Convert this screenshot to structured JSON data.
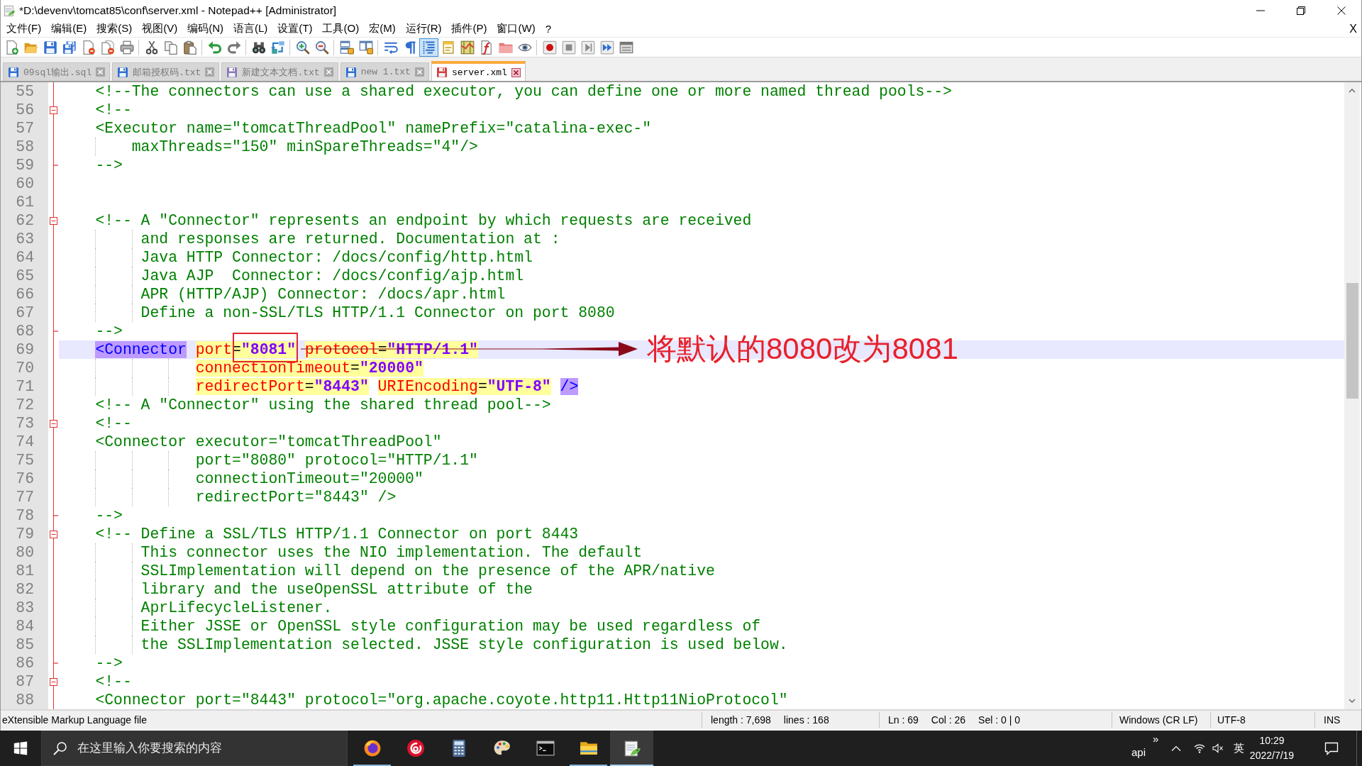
{
  "window": {
    "title": "*D:\\devenv\\tomcat85\\conf\\server.xml - Notepad++ [Administrator]"
  },
  "menu": {
    "items": [
      "文件(F)",
      "编辑(E)",
      "搜索(S)",
      "视图(V)",
      "编码(N)",
      "语言(L)",
      "设置(T)",
      "工具(O)",
      "宏(M)",
      "运行(R)",
      "插件(P)",
      "窗口(W)",
      "?"
    ],
    "close": "X"
  },
  "toolbar": [
    [
      {
        "kind": "new",
        "pressed": false
      },
      {
        "kind": "open",
        "pressed": false
      },
      {
        "kind": "save",
        "pressed": false
      },
      {
        "kind": "saveall",
        "pressed": false
      },
      {
        "kind": "close",
        "pressed": false
      },
      {
        "kind": "closeall",
        "pressed": false
      },
      {
        "kind": "print",
        "pressed": false
      }
    ],
    [
      {
        "kind": "cut",
        "pressed": false
      },
      {
        "kind": "copy",
        "pressed": false
      },
      {
        "kind": "paste",
        "pressed": false
      }
    ],
    [
      {
        "kind": "undo",
        "pressed": false
      },
      {
        "kind": "redo",
        "pressed": false
      }
    ],
    [
      {
        "kind": "find",
        "pressed": false
      },
      {
        "kind": "replace",
        "pressed": false
      }
    ],
    [
      {
        "kind": "zoomin",
        "pressed": false
      },
      {
        "kind": "zoomout",
        "pressed": false
      }
    ],
    [
      {
        "kind": "syncv",
        "pressed": false
      },
      {
        "kind": "synch",
        "pressed": false
      }
    ],
    [
      {
        "kind": "wrap",
        "pressed": false
      },
      {
        "kind": "allchars",
        "pressed": false
      },
      {
        "kind": "indent",
        "pressed": true
      },
      {
        "kind": "udl",
        "pressed": false
      },
      {
        "kind": "docmap",
        "pressed": false
      },
      {
        "kind": "funclist",
        "pressed": false
      },
      {
        "kind": "folder",
        "pressed": false
      },
      {
        "kind": "monitor",
        "pressed": false
      }
    ],
    [
      {
        "kind": "record",
        "pressed": false
      },
      {
        "kind": "stop",
        "pressed": false
      },
      {
        "kind": "play",
        "pressed": false
      },
      {
        "kind": "playmulti",
        "pressed": false
      },
      {
        "kind": "savemacro",
        "pressed": false
      }
    ]
  ],
  "tabs": [
    {
      "label": "09sql输出.sql",
      "modified": false,
      "readonly": false,
      "selected": false
    },
    {
      "label": "邮箱授权码.txt",
      "modified": false,
      "readonly": false,
      "selected": false
    },
    {
      "label": "新建文本文档.txt",
      "modified": false,
      "readonly": true,
      "selected": false
    },
    {
      "label": "new 1.txt",
      "modified": false,
      "readonly": false,
      "selected": false
    },
    {
      "label": "server.xml",
      "modified": true,
      "readonly": false,
      "selected": true
    }
  ],
  "editor": {
    "lines": [
      {
        "number": "55",
        "current": false,
        "kind": "comment",
        "text": "    <!--The connectors can use a shared executor, you can define one or more named thread pools-->"
      },
      {
        "number": "56",
        "current": false,
        "fold": {
          "kind": "open"
        },
        "kind": "comment",
        "text": "    <!--"
      },
      {
        "number": "57",
        "current": false,
        "kind": "comment",
        "text": "    <Executor name=\"tomcatThreadPool\" namePrefix=\"catalina-exec-\""
      },
      {
        "number": "58",
        "current": false,
        "kind": "comment",
        "text": "        maxThreads=\"150\" minSpareThreads=\"4\"/>"
      },
      {
        "number": "59",
        "current": false,
        "fold": {
          "kind": "end"
        },
        "kind": "comment",
        "text": "    -->"
      },
      {
        "number": "60",
        "current": false,
        "kind": "blank"
      },
      {
        "number": "61",
        "current": false,
        "kind": "blank"
      },
      {
        "number": "62",
        "current": false,
        "fold": {
          "kind": "open"
        },
        "kind": "comment",
        "text": "    <!-- A \"Connector\" represents an endpoint by which requests are received"
      },
      {
        "number": "63",
        "current": false,
        "kind": "comment",
        "text": "         and responses are returned. Documentation at :"
      },
      {
        "number": "64",
        "current": false,
        "kind": "comment",
        "text": "         Java HTTP Connector: /docs/config/http.html"
      },
      {
        "number": "65",
        "current": false,
        "kind": "comment",
        "text": "         Java AJP  Connector: /docs/config/ajp.html"
      },
      {
        "number": "66",
        "current": false,
        "kind": "comment",
        "text": "         APR (HTTP/AJP) Connector: /docs/apr.html"
      },
      {
        "number": "67",
        "current": false,
        "kind": "comment",
        "text": "         Define a non-SSL/TLS HTTP/1.1 Connector on port 8080"
      },
      {
        "number": "68",
        "current": false,
        "fold": {
          "kind": "end"
        },
        "kind": "comment",
        "text": "    -->"
      },
      {
        "number": "69",
        "current": true,
        "kind": "markup",
        "segments": [
          {
            "kind": "tag",
            "text": "    <Connector",
            "highlighted": true
          },
          {
            "kind": "attr",
            "text": " port",
            "highlighted": true
          },
          {
            "kind": "eq",
            "text": "=",
            "highlighted": true
          },
          {
            "kind": "value",
            "text": "\"8081\"",
            "highlighted": true
          },
          {
            "kind": "attr",
            "text": " protocol",
            "highlighted": true
          },
          {
            "kind": "eq",
            "text": "=",
            "highlighted": true
          },
          {
            "kind": "value",
            "text": "\"HTTP/1.1\"",
            "highlighted": true
          }
        ]
      },
      {
        "number": "70",
        "current": false,
        "kind": "markup",
        "segments": [
          {
            "kind": "attr",
            "text": "               connectionTimeout",
            "highlighted": true
          },
          {
            "kind": "eq",
            "text": "=",
            "highlighted": true
          },
          {
            "kind": "value",
            "text": "\"20000\"",
            "highlighted": true
          }
        ]
      },
      {
        "number": "71",
        "current": false,
        "kind": "markup",
        "segments": [
          {
            "kind": "attr",
            "text": "               redirectPort",
            "highlighted": true
          },
          {
            "kind": "eq",
            "text": "=",
            "highlighted": true
          },
          {
            "kind": "value",
            "text": "\"8443\"",
            "highlighted": true
          },
          {
            "kind": "attr",
            "text": " URIEncoding",
            "highlighted": true
          },
          {
            "kind": "eq",
            "text": "=",
            "highlighted": true
          },
          {
            "kind": "value",
            "text": "\"UTF-8\"",
            "highlighted": true
          },
          {
            "kind": "tag",
            "text": " />",
            "highlighted": true
          }
        ]
      },
      {
        "number": "72",
        "current": false,
        "kind": "comment",
        "text": "    <!-- A \"Connector\" using the shared thread pool-->"
      },
      {
        "number": "73",
        "current": false,
        "fold": {
          "kind": "open"
        },
        "kind": "comment",
        "text": "    <!--"
      },
      {
        "number": "74",
        "current": false,
        "kind": "comment",
        "text": "    <Connector executor=\"tomcatThreadPool\""
      },
      {
        "number": "75",
        "current": false,
        "kind": "comment",
        "text": "               port=\"8080\" protocol=\"HTTP/1.1\""
      },
      {
        "number": "76",
        "current": false,
        "kind": "comment",
        "text": "               connectionTimeout=\"20000\""
      },
      {
        "number": "77",
        "current": false,
        "kind": "comment",
        "text": "               redirectPort=\"8443\" />"
      },
      {
        "number": "78",
        "current": false,
        "fold": {
          "kind": "end"
        },
        "kind": "comment",
        "text": "    -->"
      },
      {
        "number": "79",
        "current": false,
        "fold": {
          "kind": "open"
        },
        "kind": "comment",
        "text": "    <!-- Define a SSL/TLS HTTP/1.1 Connector on port 8443"
      },
      {
        "number": "80",
        "current": false,
        "kind": "comment",
        "text": "         This connector uses the NIO implementation. The default"
      },
      {
        "number": "81",
        "current": false,
        "kind": "comment",
        "text": "         SSLImplementation will depend on the presence of the APR/native"
      },
      {
        "number": "82",
        "current": false,
        "kind": "comment",
        "text": "         library and the useOpenSSL attribute of the"
      },
      {
        "number": "83",
        "current": false,
        "kind": "comment",
        "text": "         AprLifecycleListener."
      },
      {
        "number": "84",
        "current": false,
        "kind": "comment",
        "text": "         Either JSSE or OpenSSL style configuration may be used regardless of"
      },
      {
        "number": "85",
        "current": false,
        "kind": "comment",
        "text": "         the SSLImplementation selected. JSSE style configuration is used below."
      },
      {
        "number": "86",
        "current": false,
        "fold": {
          "kind": "end"
        },
        "kind": "comment",
        "text": "    -->"
      },
      {
        "number": "87",
        "current": false,
        "fold": {
          "kind": "open"
        },
        "kind": "comment",
        "text": "    <!--"
      },
      {
        "number": "88",
        "current": false,
        "kind": "comment",
        "text": "    <Connector port=\"8443\" protocol=\"org.apache.coyote.http11.Http11NioProtocol\""
      }
    ]
  },
  "annotation": {
    "text": "将默认的8080改为8081"
  },
  "status_bar": {
    "sections": [
      [
        "eXtensible Markup Language file"
      ],
      [
        "length : 7,698",
        "lines : 168"
      ],
      [
        "Ln : 69",
        "Col : 26",
        "Sel : 0 | 0"
      ],
      [
        "Windows (CR LF)"
      ],
      [
        "UTF-8"
      ],
      [
        "INS"
      ]
    ]
  },
  "taskbar": {
    "search": {
      "placeholder": "在这里输入你要搜索的内容"
    },
    "apps": [
      {
        "kind": "browser",
        "running": true,
        "selected": false
      },
      {
        "kind": "music",
        "running": false,
        "selected": false
      },
      {
        "kind": "calculator",
        "running": false,
        "selected": false
      },
      {
        "kind": "paint",
        "running": false,
        "selected": false
      },
      {
        "kind": "terminal",
        "running": false,
        "selected": false
      },
      {
        "kind": "explorer",
        "running": true,
        "selected": false
      },
      {
        "kind": "editor",
        "running": true,
        "selected": true
      }
    ],
    "tray": {
      "toolbar": "api",
      "overflow": "»",
      "ime": "英",
      "time": "10:29",
      "date": "2022/7/19"
    }
  }
}
